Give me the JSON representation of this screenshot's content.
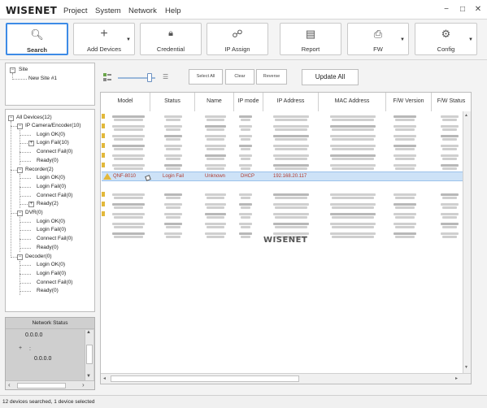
{
  "app": {
    "logo": "WISENET",
    "logo_dot": ".",
    "window_controls": [
      "−",
      "□",
      "✕"
    ]
  },
  "menu": [
    "Project",
    "System",
    "Network",
    "Help"
  ],
  "toolbar": [
    {
      "label": "Search",
      "icon": "search-icon",
      "glyph": "🔍︎",
      "active": true,
      "dropdown": false
    },
    {
      "label": "Add Devices",
      "icon": "plus-icon",
      "glyph": "+",
      "active": false,
      "dropdown": true
    },
    {
      "label": "Credential",
      "icon": "lock-icon",
      "glyph": "🔒︎",
      "active": false,
      "dropdown": false
    },
    {
      "label": "IP Assign",
      "icon": "network-icon",
      "glyph": "☍",
      "active": false,
      "dropdown": false
    },
    {
      "label": "Report",
      "icon": "report-icon",
      "glyph": "▤",
      "active": false,
      "dropdown": false
    },
    {
      "label": "FW",
      "icon": "firmware-icon",
      "glyph": "⎙",
      "active": false,
      "dropdown": true
    },
    {
      "label": "Config",
      "icon": "gear-icon",
      "glyph": "⚙",
      "active": false,
      "dropdown": true
    }
  ],
  "site_tree": {
    "root": "Site",
    "child": "New Site #1"
  },
  "device_tree": {
    "root": "All Devices(12)",
    "groups": [
      {
        "label": "IP Camera/Encoder(10)",
        "items": [
          "Login OK(0)",
          "Login Fail(10)",
          "Connect Fail(0)",
          "Ready(0)"
        ]
      },
      {
        "label": "Recorder(2)",
        "items": [
          "Login OK(0)",
          "Login Fail(0)",
          "Connect Fail(0)",
          "Ready(2)"
        ]
      },
      {
        "label": "DVR(0)",
        "items": [
          "Login OK(0)",
          "Login Fail(0)",
          "Connect Fail(0)",
          "Ready(0)"
        ]
      },
      {
        "label": "Decoder(0)",
        "items": [
          "Login OK(0)",
          "Login Fail(0)",
          "Connect Fail(0)",
          "Ready(0)"
        ]
      }
    ]
  },
  "network_status": {
    "title": "Network Status",
    "values": [
      "0.0.0.0",
      "0.0.0.0"
    ],
    "expand": "+",
    "sep": ":"
  },
  "list_controls": {
    "zoom_level": 0.85,
    "select_all": "Select All",
    "clear": "Clear",
    "reverse": "Reverse",
    "update_all": "Update All"
  },
  "table": {
    "columns": [
      "Model",
      "Status",
      "Name",
      "IP mode",
      "IP Address",
      "MAC Address",
      "F/W Version",
      "F/W Status"
    ],
    "selected_row": {
      "model": "QNF-8010",
      "status": "Login Fail",
      "name": "Unknown",
      "ip_mode": "DHCP",
      "ip_address": "192.168.20.117"
    },
    "watermark": "WISENET"
  },
  "statusbar": {
    "text": "12 devices searched, 1 device selected"
  }
}
